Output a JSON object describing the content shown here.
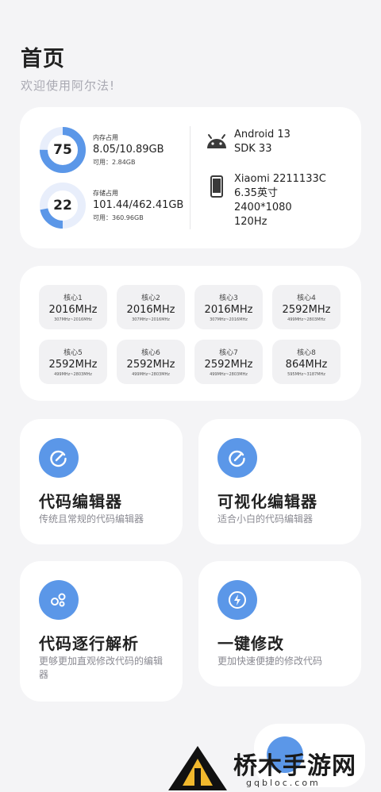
{
  "header": {
    "title": "首页",
    "subtitle": "欢迎使用阿尔法!"
  },
  "memory": {
    "percent": "75",
    "label": "内存占用",
    "value": "8.05/10.89GB",
    "available": "可用：2.84GB",
    "fraction": 0.75
  },
  "storage": {
    "percent": "22",
    "label": "存储占用",
    "value": "101.44/462.41GB",
    "available": "可用：360.96GB",
    "fraction": 0.22
  },
  "system": {
    "android": "Android 13",
    "sdk": "SDK 33",
    "android_icon": "android-icon"
  },
  "device": {
    "model": "Xiaomi 2211133C",
    "screen_size": "6.35英寸",
    "resolution": "2400*1080",
    "refresh": "120Hz",
    "phone_icon": "phone-icon"
  },
  "cpu": {
    "cores": [
      {
        "name": "核心1",
        "freq": "2016MHz",
        "range": "307MHz~2016MHz"
      },
      {
        "name": "核心2",
        "freq": "2016MHz",
        "range": "307MHz~2016MHz"
      },
      {
        "name": "核心3",
        "freq": "2016MHz",
        "range": "307MHz~2016MHz"
      },
      {
        "name": "核心4",
        "freq": "2592MHz",
        "range": "499MHz~2803MHz"
      },
      {
        "name": "核心5",
        "freq": "2592MHz",
        "range": "499MHz~2803MHz"
      },
      {
        "name": "核心6",
        "freq": "2592MHz",
        "range": "499MHz~2803MHz"
      },
      {
        "name": "核心7",
        "freq": "2592MHz",
        "range": "499MHz~2803MHz"
      },
      {
        "name": "核心8",
        "freq": "864MHz",
        "range": "595MHz~3187MHz"
      }
    ]
  },
  "features": [
    {
      "title": "代码编辑器",
      "desc": "传统且常规的代码编辑器",
      "icon": "edit-icon"
    },
    {
      "title": "可视化编辑器",
      "desc": "适合小白的代码编辑器",
      "icon": "edit-icon"
    },
    {
      "title": "代码逐行解析",
      "desc": "更够更加直观修改代码的编辑器",
      "icon": "bubbles-icon"
    },
    {
      "title": "一键修改",
      "desc": "更加快速便捷的修改代码",
      "icon": "lightning-icon"
    }
  ],
  "colors": {
    "accent": "#5b97e8",
    "ring_track": "#e8eefb",
    "background": "#f4f4f6",
    "card": "#ffffff"
  },
  "watermark": {
    "name": "桥木手游网",
    "url": "gqbloc.com"
  }
}
